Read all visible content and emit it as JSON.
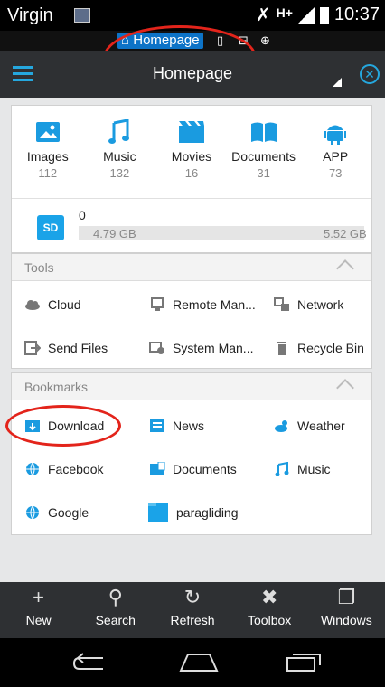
{
  "status": {
    "carrier": "Virgin",
    "network": "H+",
    "time": "10:37"
  },
  "window_tabs": {
    "active": "Homepage"
  },
  "actionbar": {
    "title": "Homepage"
  },
  "categories": [
    {
      "label": "Images",
      "count": "112",
      "icon": "image-icon",
      "color": "#1a9be0"
    },
    {
      "label": "Music",
      "count": "132",
      "icon": "music-icon",
      "color": "#1a9be0"
    },
    {
      "label": "Movies",
      "count": "16",
      "icon": "movie-icon",
      "color": "#1a9be0"
    },
    {
      "label": "Documents",
      "count": "31",
      "icon": "book-icon",
      "color": "#1a9be0"
    },
    {
      "label": "APP",
      "count": "73",
      "icon": "android-icon",
      "color": "#1a9be0"
    }
  ],
  "storage": {
    "badge": "SD",
    "count": "0",
    "used": "4.79 GB",
    "total": "5.52 GB"
  },
  "tools": {
    "title": "Tools",
    "items": [
      "Cloud",
      "Remote Man...",
      "Network",
      "Send Files",
      "System Man...",
      "Recycle Bin"
    ]
  },
  "bookmarks": {
    "title": "Bookmarks",
    "items": [
      "Download",
      "News",
      "Weather",
      "Facebook",
      "Documents",
      "Music",
      "Google",
      "paragliding"
    ]
  },
  "toolbar": {
    "new": "New",
    "search": "Search",
    "refresh": "Refresh",
    "toolbox": "Toolbox",
    "windows": "Windows"
  },
  "colors": {
    "accent": "#1a9be0",
    "annotation": "#e3241b",
    "bar": "#2e3033"
  }
}
